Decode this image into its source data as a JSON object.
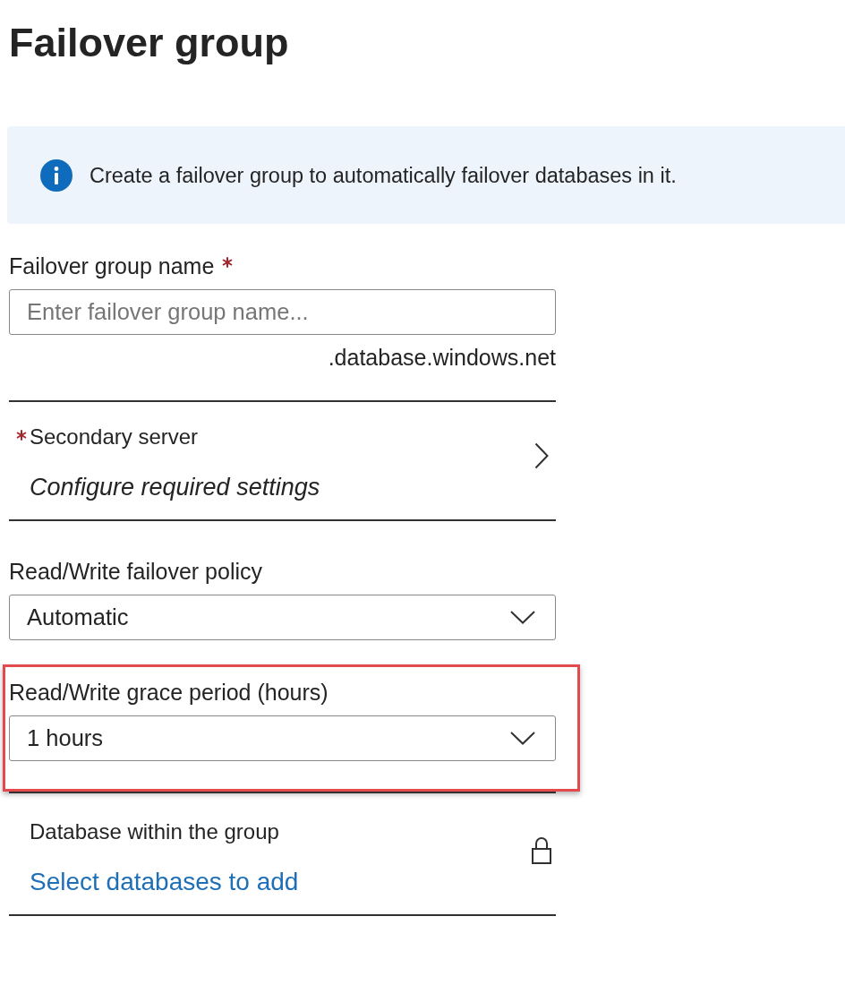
{
  "title": "Failover group",
  "info_banner": {
    "text": "Create a failover group to automatically failover databases in it."
  },
  "sections": [
    {
      "fields": [
        {
          "kind": "text",
          "label": "Failover group name",
          "required": true,
          "placeholder": "Enter failover group name...",
          "suffix": ".database.windows.net",
          "highlighted": false
        }
      ]
    },
    {
      "fields": [
        {
          "kind": "picker",
          "label": "Secondary server",
          "required": true,
          "value": "Configure required settings",
          "locked": false,
          "highlighted": false
        }
      ]
    },
    {
      "fields": [
        {
          "kind": "dropdown",
          "label": "Read/Write failover policy",
          "required": false,
          "value": "Automatic",
          "highlighted": false
        },
        {
          "kind": "dropdown",
          "label": "Read/Write grace period (hours)",
          "required": false,
          "value": "1 hours",
          "highlighted": true
        }
      ]
    },
    {
      "fields": [
        {
          "kind": "link",
          "label": "Database within the group",
          "required": false,
          "value": "Select databases to add",
          "locked": true,
          "highlighted": false
        }
      ]
    }
  ]
}
